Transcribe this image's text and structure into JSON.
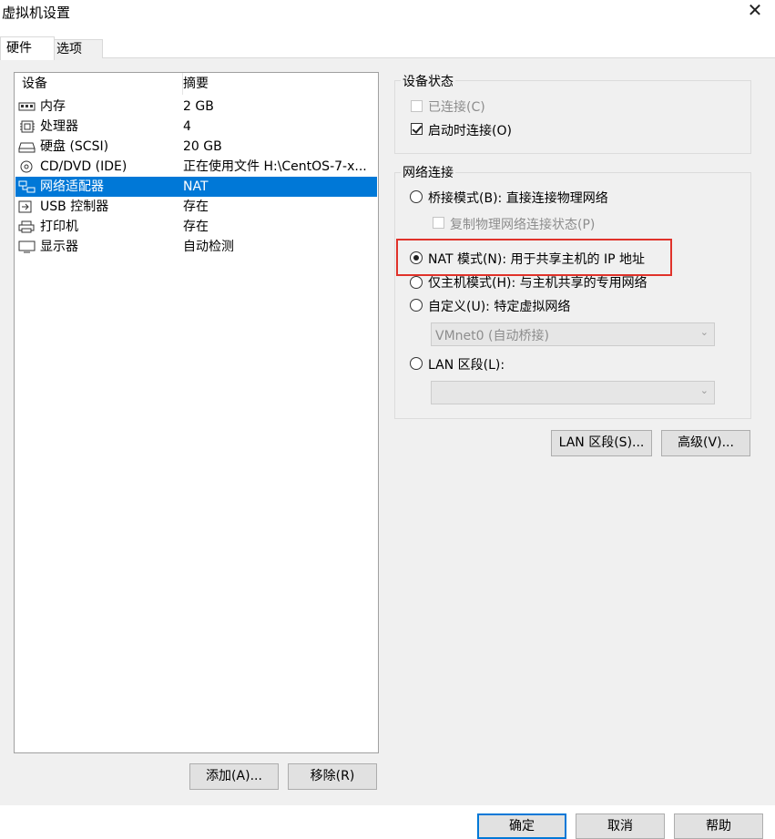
{
  "window": {
    "title": "虚拟机设置"
  },
  "tabs": [
    {
      "label": "硬件"
    },
    {
      "label": "选项"
    }
  ],
  "device_list": {
    "headers": {
      "device": "设备",
      "summary": "摘要"
    },
    "rows": [
      {
        "icon": "memory-icon",
        "name": "内存",
        "summary": "2 GB"
      },
      {
        "icon": "cpu-icon",
        "name": "处理器",
        "summary": "4"
      },
      {
        "icon": "harddisk-icon",
        "name": "硬盘 (SCSI)",
        "summary": "20 GB"
      },
      {
        "icon": "cd-dvd-icon",
        "name": "CD/DVD (IDE)",
        "summary": "正在使用文件 H:\\CentOS-7-x..."
      },
      {
        "icon": "network-adapter-icon",
        "name": "网络适配器",
        "summary": "NAT"
      },
      {
        "icon": "usb-icon",
        "name": "USB 控制器",
        "summary": "存在"
      },
      {
        "icon": "printer-icon",
        "name": "打印机",
        "summary": "存在"
      },
      {
        "icon": "display-icon",
        "name": "显示器",
        "summary": "自动检测"
      }
    ],
    "selected_index": 4
  },
  "list_buttons": {
    "add": "添加(A)...",
    "remove": "移除(R)"
  },
  "device_status": {
    "legend": "设备状态",
    "connected": {
      "label": "已连接(C)",
      "checked": false,
      "disabled": true
    },
    "connect_at_power_on": {
      "label": "启动时连接(O)",
      "checked": true
    }
  },
  "network": {
    "legend": "网络连接",
    "bridged": {
      "label": "桥接模式(B): 直接连接物理网络"
    },
    "replicate": {
      "label": "复制物理网络连接状态(P)"
    },
    "nat": {
      "label": "NAT 模式(N): 用于共享主机的 IP 地址"
    },
    "host_only": {
      "label": "仅主机模式(H): 与主机共享的专用网络"
    },
    "custom": {
      "label": "自定义(U): 特定虚拟网络"
    },
    "custom_select": {
      "value": "VMnet0 (自动桥接)"
    },
    "lan_segment": {
      "label": "LAN 区段(L):"
    },
    "lan_select": {
      "value": ""
    },
    "selected": "nat"
  },
  "adapter_buttons": {
    "lan_segments": "LAN 区段(S)...",
    "advanced": "高级(V)..."
  },
  "footer_buttons": {
    "ok": "确定",
    "cancel": "取消",
    "help": "帮助"
  },
  "colors": {
    "selection": "#0078d7",
    "highlight_box": "#e0322a",
    "panel_bg": "#f0f0f0"
  }
}
